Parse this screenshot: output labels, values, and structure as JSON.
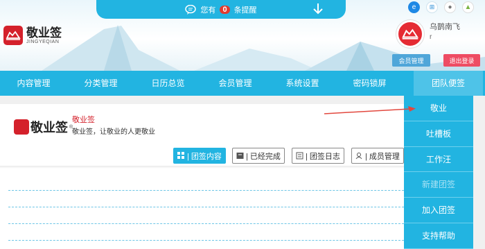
{
  "notify": {
    "prefix": "您有",
    "count": "0",
    "suffix": "条提醒"
  },
  "logo": {
    "title": "敬业签",
    "subtitle": "JINGYEQIAN"
  },
  "browsers": [
    "ie-icon",
    "windows-icon",
    "apple-icon",
    "android-icon"
  ],
  "user": {
    "name": "乌鹊南飞",
    "sub": "r"
  },
  "buttons": {
    "member": "会员管理",
    "logout": "退出登录"
  },
  "nav": [
    "内容管理",
    "分类管理",
    "日历总览",
    "会员管理",
    "系统设置",
    "密码锁屏",
    "团队便签"
  ],
  "app": {
    "brand": "敬业签",
    "title": "敬业签",
    "desc": "敬业签，让敬业的人更敬业"
  },
  "tabs": [
    {
      "label": "| 团签内容",
      "icon": "grid-icon"
    },
    {
      "label": "| 已经完成",
      "icon": "archive-icon"
    },
    {
      "label": "| 团签日志",
      "icon": "log-icon"
    },
    {
      "label": "| 成员管理",
      "icon": "members-icon"
    }
  ],
  "dropdown": [
    "敬业",
    "吐槽板",
    "工作汪",
    "新建团签",
    "加入团签",
    "支持帮助"
  ],
  "colors": {
    "primary": "#22b4e1",
    "brand_red": "#d4212b",
    "logout": "#ee4c63"
  }
}
